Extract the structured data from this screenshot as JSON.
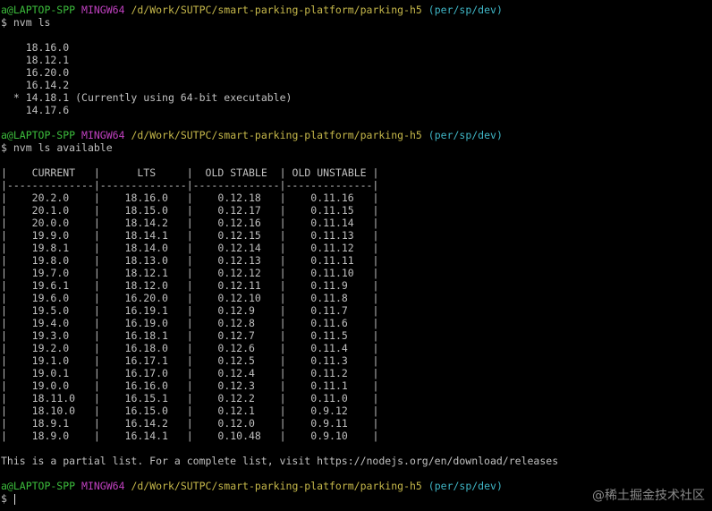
{
  "prompt": {
    "user": "a@LAPTOP-SPP",
    "system": "MINGW64",
    "path": "/d/Work/SUTPC/smart-parking-platform/parking-h5",
    "branch": "(per/sp/dev)",
    "symbol": "$"
  },
  "cmd1": "nvm ls",
  "installed": [
    {
      "marker": " ",
      "version": "18.16.0",
      "note": ""
    },
    {
      "marker": " ",
      "version": "18.12.1",
      "note": ""
    },
    {
      "marker": " ",
      "version": "16.20.0",
      "note": ""
    },
    {
      "marker": " ",
      "version": "16.14.2",
      "note": ""
    },
    {
      "marker": "*",
      "version": "14.18.1",
      "note": "(Currently using 64-bit executable)"
    },
    {
      "marker": " ",
      "version": "14.17.6",
      "note": ""
    }
  ],
  "cmd2": "nvm ls available",
  "table": {
    "headers": [
      "CURRENT",
      "LTS",
      "OLD STABLE",
      "OLD UNSTABLE"
    ],
    "rows": [
      [
        "20.2.0",
        "18.16.0",
        "0.12.18",
        "0.11.16"
      ],
      [
        "20.1.0",
        "18.15.0",
        "0.12.17",
        "0.11.15"
      ],
      [
        "20.0.0",
        "18.14.2",
        "0.12.16",
        "0.11.14"
      ],
      [
        "19.9.0",
        "18.14.1",
        "0.12.15",
        "0.11.13"
      ],
      [
        "19.8.1",
        "18.14.0",
        "0.12.14",
        "0.11.12"
      ],
      [
        "19.8.0",
        "18.13.0",
        "0.12.13",
        "0.11.11"
      ],
      [
        "19.7.0",
        "18.12.1",
        "0.12.12",
        "0.11.10"
      ],
      [
        "19.6.1",
        "18.12.0",
        "0.12.11",
        "0.11.9"
      ],
      [
        "19.6.0",
        "16.20.0",
        "0.12.10",
        "0.11.8"
      ],
      [
        "19.5.0",
        "16.19.1",
        "0.12.9",
        "0.11.7"
      ],
      [
        "19.4.0",
        "16.19.0",
        "0.12.8",
        "0.11.6"
      ],
      [
        "19.3.0",
        "16.18.1",
        "0.12.7",
        "0.11.5"
      ],
      [
        "19.2.0",
        "16.18.0",
        "0.12.6",
        "0.11.4"
      ],
      [
        "19.1.0",
        "16.17.1",
        "0.12.5",
        "0.11.3"
      ],
      [
        "19.0.1",
        "16.17.0",
        "0.12.4",
        "0.11.2"
      ],
      [
        "19.0.0",
        "16.16.0",
        "0.12.3",
        "0.11.1"
      ],
      [
        "18.11.0",
        "16.15.1",
        "0.12.2",
        "0.11.0"
      ],
      [
        "18.10.0",
        "16.15.0",
        "0.12.1",
        "0.9.12"
      ],
      [
        "18.9.1",
        "16.14.2",
        "0.12.0",
        "0.9.11"
      ],
      [
        "18.9.0",
        "16.14.1",
        "0.10.48",
        "0.9.10"
      ]
    ]
  },
  "footer_note": "This is a partial list. For a complete list, visit https://nodejs.org/en/download/releases",
  "watermark": "@稀土掘金技术社区",
  "colors": {
    "background": "#000000",
    "text": "#c0c0c0",
    "user": "#3cbd3c",
    "system": "#bf40bf",
    "path": "#c6b84a",
    "branch": "#3fb6c6"
  }
}
